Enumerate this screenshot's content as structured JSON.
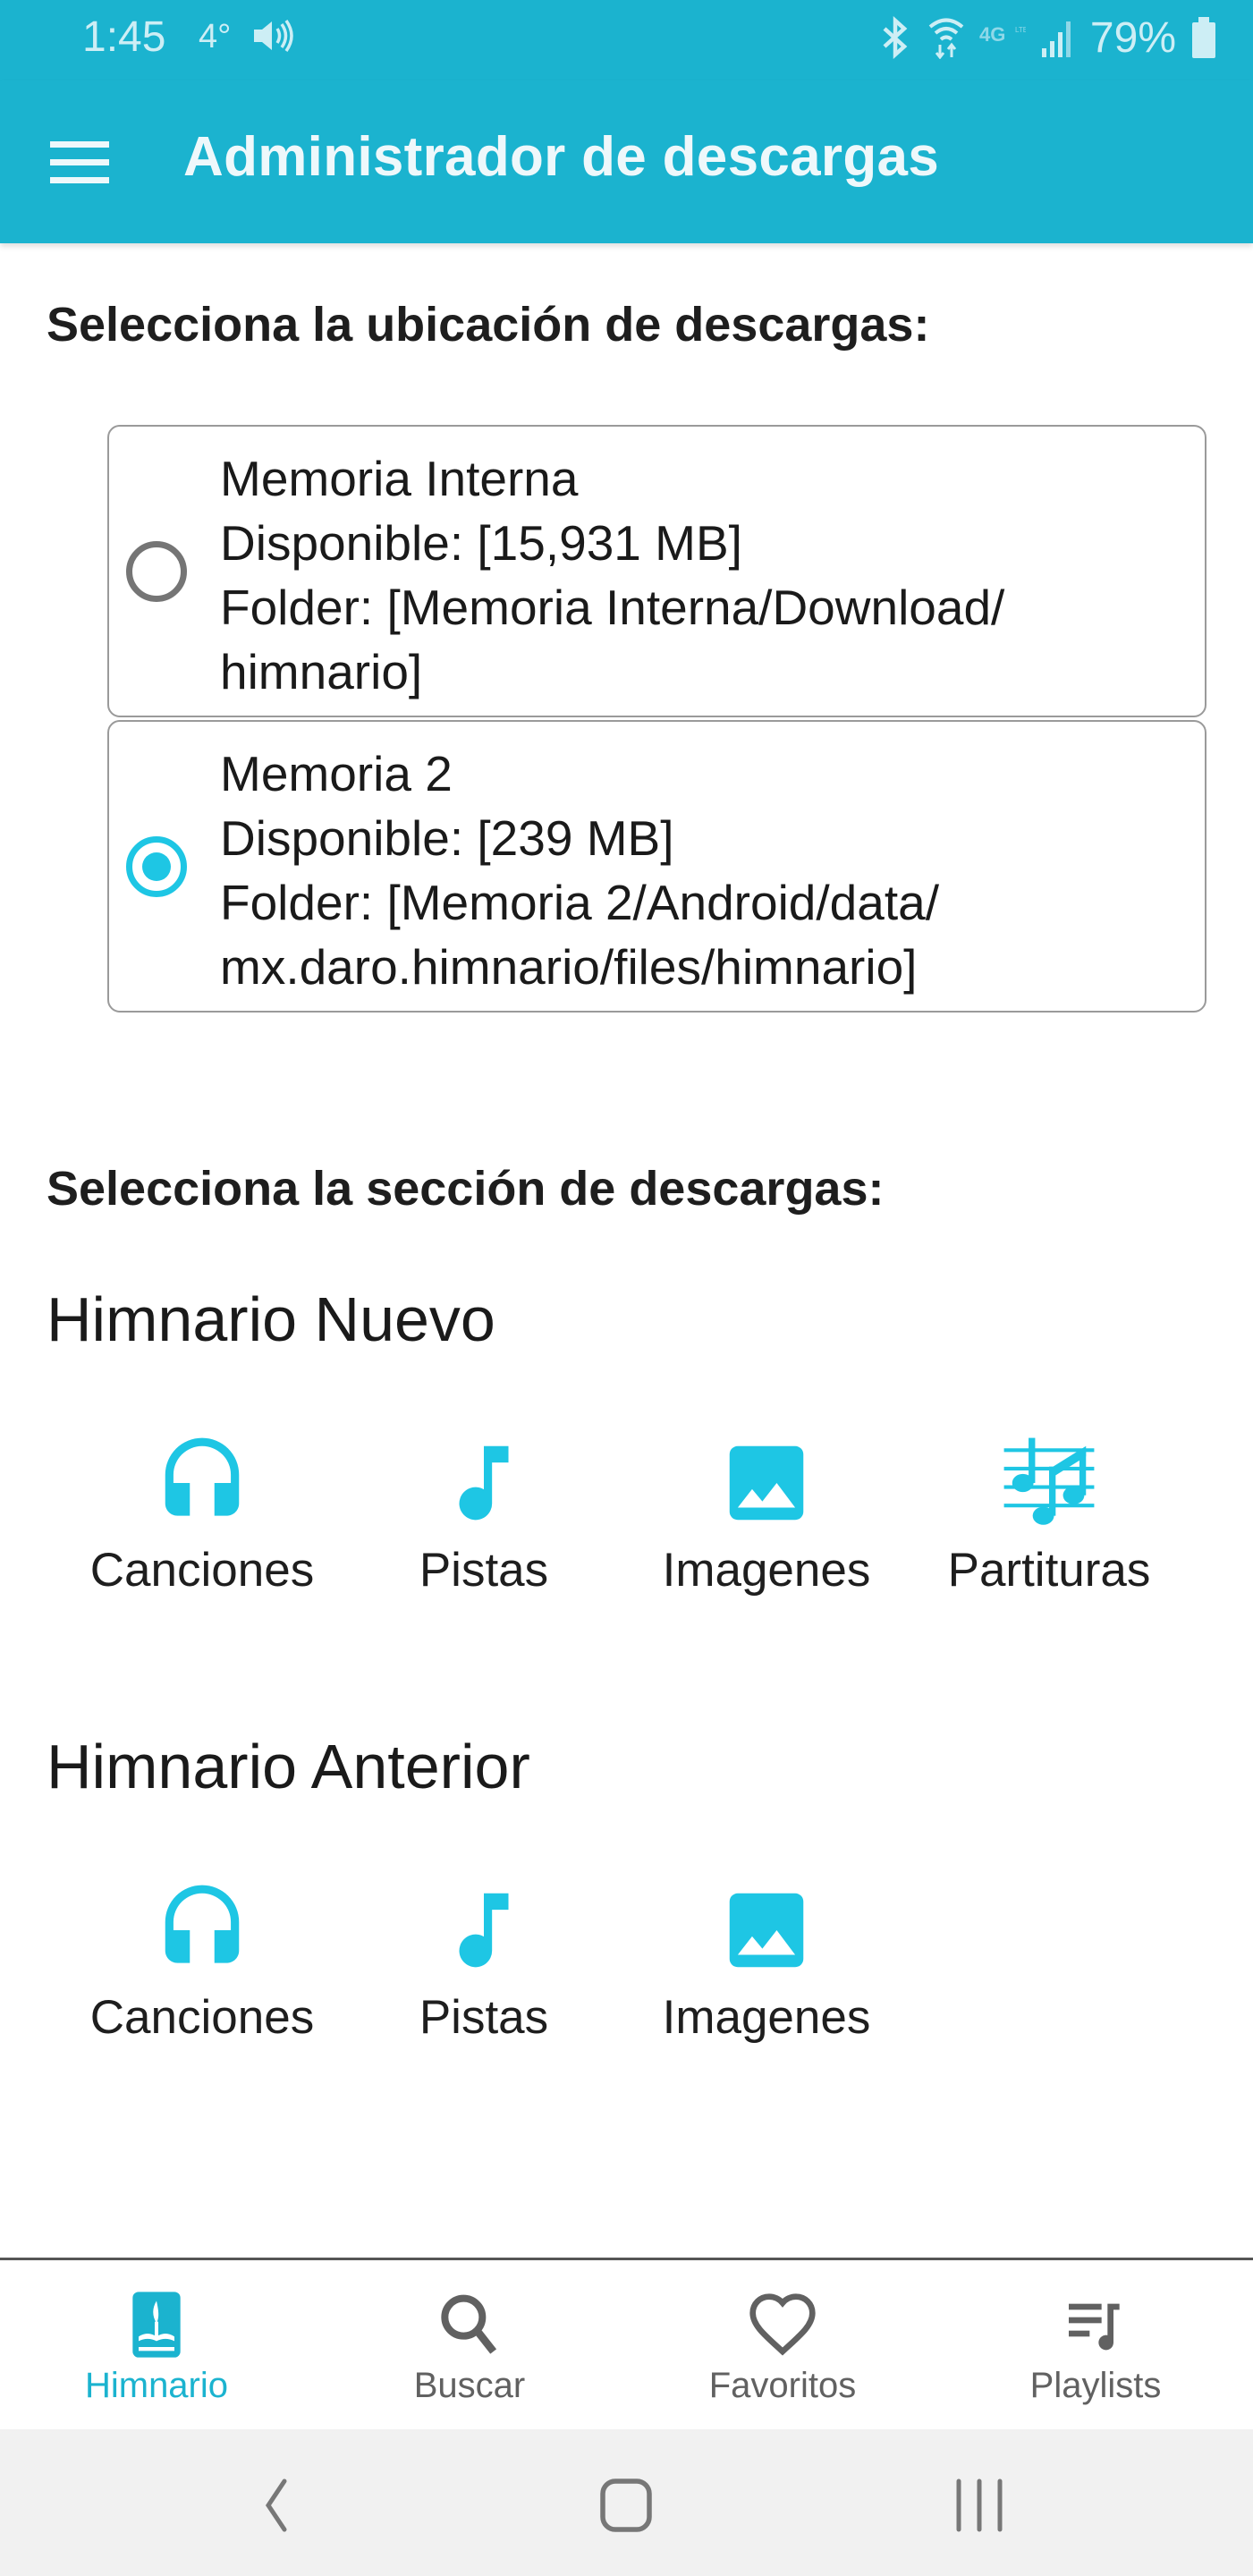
{
  "status_bar": {
    "time": "1:45",
    "temperature": "4°",
    "battery_percent": "79%",
    "network": "4G LTE",
    "icons": [
      "volume-icon",
      "bluetooth-icon",
      "wifi-icon",
      "network-4g-icon",
      "signal-icon",
      "battery-icon"
    ]
  },
  "toolbar": {
    "title": "Administrador de descargas",
    "menu_icon": "hamburger-menu-icon"
  },
  "location_section": {
    "heading": "Selecciona la ubicación de descargas:",
    "options": [
      {
        "name": "Memoria Interna",
        "available": "Disponible: [15,931 MB]",
        "folder_line1": "Folder: [Memoria Interna/Download/",
        "folder_line2": "himnario]",
        "selected": false
      },
      {
        "name": "Memoria 2",
        "available": "Disponible: [239 MB]",
        "folder_line1": "Folder: [Memoria 2/Android/data/",
        "folder_line2": "mx.daro.himnario/files/himnario]",
        "selected": true
      }
    ]
  },
  "download_section": {
    "heading": "Selecciona la sección de descargas:",
    "groups": [
      {
        "title": "Himnario Nuevo",
        "items": [
          {
            "label": "Canciones",
            "icon": "headphones-icon"
          },
          {
            "label": "Pistas",
            "icon": "music-note-icon"
          },
          {
            "label": "Imagenes",
            "icon": "image-icon"
          },
          {
            "label": "Partituras",
            "icon": "sheet-music-icon"
          }
        ]
      },
      {
        "title": "Himnario Anterior",
        "items": [
          {
            "label": "Canciones",
            "icon": "headphones-icon"
          },
          {
            "label": "Pistas",
            "icon": "music-note-icon"
          },
          {
            "label": "Imagenes",
            "icon": "image-icon"
          }
        ]
      }
    ]
  },
  "bottom_nav": {
    "items": [
      {
        "label": "Himnario",
        "icon": "hymnal-book-icon",
        "active": true
      },
      {
        "label": "Buscar",
        "icon": "search-icon",
        "active": false
      },
      {
        "label": "Favoritos",
        "icon": "heart-icon",
        "active": false
      },
      {
        "label": "Playlists",
        "icon": "playlist-icon",
        "active": false
      }
    ]
  },
  "colors": {
    "primary": "#1bb3cf",
    "accent": "#1ec6e4",
    "text": "#1a1a1a",
    "inactive": "#616161"
  }
}
